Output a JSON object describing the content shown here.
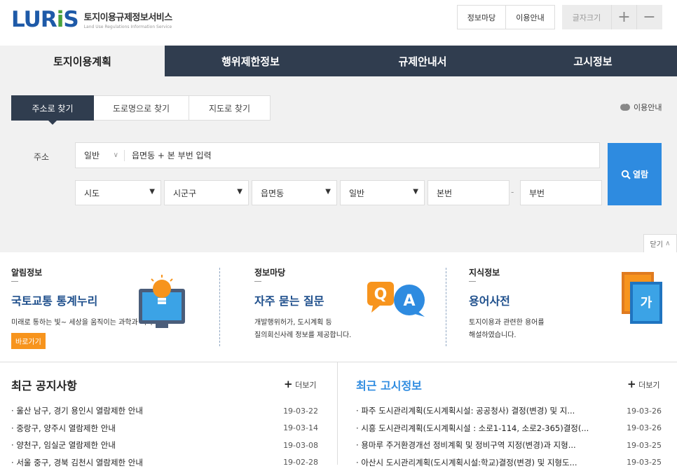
{
  "header": {
    "logo_mark_a": "LUR",
    "logo_mark_i": "i",
    "logo_mark_s": "S",
    "logo_ko": "토지이용규제정보서비스",
    "logo_en": "Land Use Regulations Information Service",
    "buttons": [
      "정보마당",
      "이용안내"
    ],
    "font_size_label": "글자크기",
    "font_plus": "+",
    "font_minus": "−"
  },
  "mainnav": {
    "tabs": [
      "토지이용계획",
      "행위제한정보",
      "규제안내서",
      "고시정보"
    ],
    "active_index": 0
  },
  "search": {
    "tabs": [
      "주소로 찾기",
      "도로명으로 찾기",
      "지도로 찾기"
    ],
    "active_tab": 0,
    "guide_link": "이용안내",
    "address_label": "주소",
    "address_type": "일반",
    "address_placeholder": "읍면동 + 본 부번 입력",
    "selects": [
      "시도",
      "시군구",
      "읍면동",
      "일반"
    ],
    "main_no": "본번",
    "dash": "-",
    "sub_no": "부번",
    "view_button": "열람",
    "close_button": "닫기"
  },
  "info": {
    "col1": {
      "head": "알림정보",
      "title": "국토교통 통계누리",
      "desc": "미래로 통하는 빛~ 세상을 움직이는 과학과 이야기~",
      "button": "바로가기"
    },
    "col2": {
      "head": "정보마당",
      "title": "자주 묻는 질문",
      "desc1": "개발행위허가, 도시계획 등",
      "desc2": "질의회신사례 정보를 제공합니다.",
      "icon_q": "Q",
      "icon_a": "A"
    },
    "col3": {
      "head": "지식정보",
      "title": "용어사전",
      "desc1": "토지이용과 관련한 용어를",
      "desc2": "해설하였습니다.",
      "book_glyph": "가"
    }
  },
  "notices": {
    "title": "최근 공지사항",
    "more": "더보기",
    "items": [
      {
        "text": "울산 남구, 경기 용인시 열람제한 안내",
        "date": "19-03-22"
      },
      {
        "text": "중랑구, 양주시 열람제한 안내",
        "date": "19-03-14"
      },
      {
        "text": "양천구, 임실군 열람제한 안내",
        "date": "19-03-08"
      },
      {
        "text": "서울 중구, 경북 김천시 열람제한 안내",
        "date": "19-02-28"
      }
    ]
  },
  "gosi": {
    "title": "최근 고시정보",
    "more": "더보기",
    "items": [
      {
        "text": "파주 도시관리계획(도시계획시설: 공공청사) 결정(변경) 및 지...",
        "date": "19-03-26"
      },
      {
        "text": "시흥 도시관리계획(도시계획시설 : 소로1-114, 소로2-365)결정(...",
        "date": "19-03-26"
      },
      {
        "text": "용마루 주거환경개선 정비계획 및 정비구역 지정(변경)과 지형...",
        "date": "19-03-25"
      },
      {
        "text": "아산시 도시관리계획(도시계획시설:학교)결정(변경) 및 지형도...",
        "date": "19-03-25"
      }
    ]
  },
  "colors": {
    "nav_dark": "#303d4f",
    "accent_blue": "#2e8be0",
    "orange": "#f7941d",
    "title_blue": "#1e4f8c"
  }
}
